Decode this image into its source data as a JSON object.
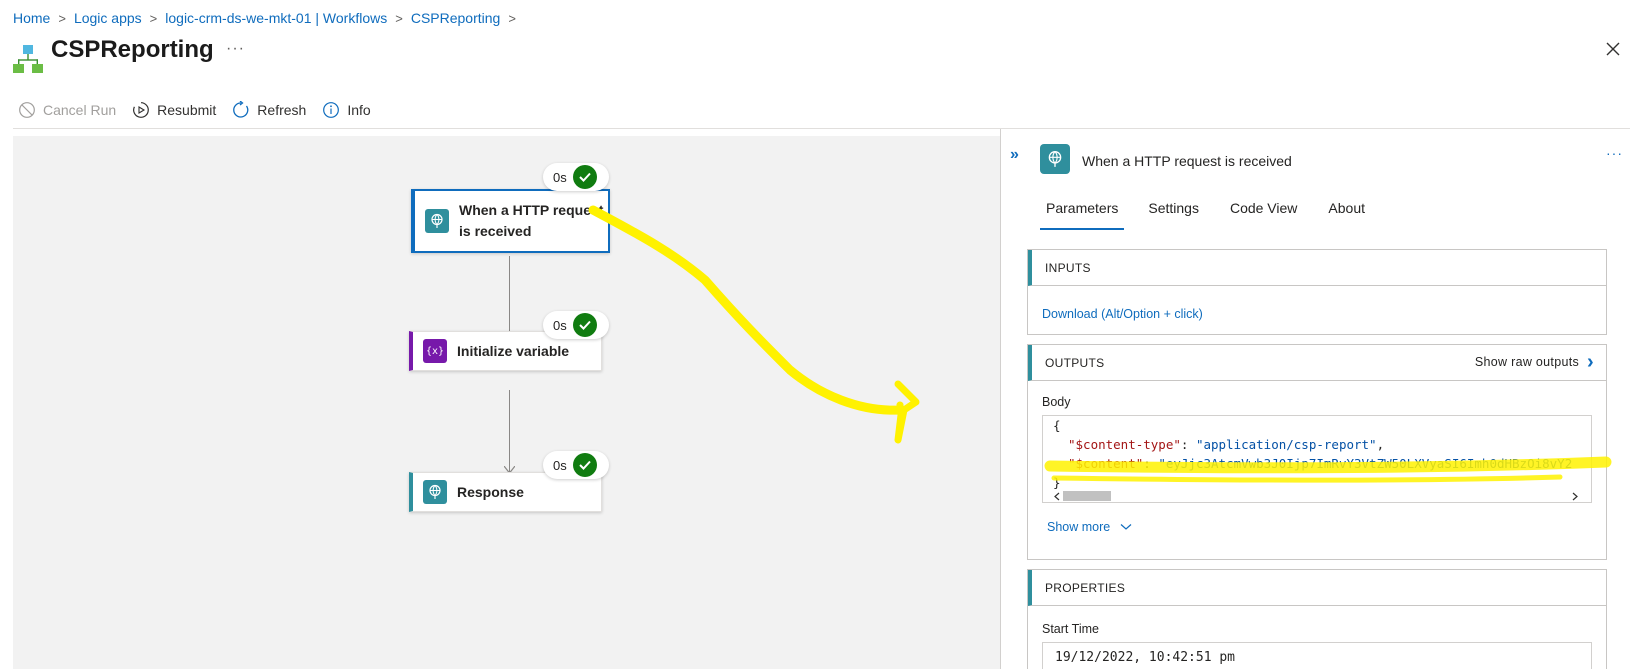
{
  "breadcrumb": {
    "items": [
      "Home",
      "Logic apps",
      "logic-crm-ds-we-mkt-01 | Workflows",
      "CSPReporting"
    ],
    "separator": ">"
  },
  "header": {
    "title": "CSPReporting",
    "more": "···"
  },
  "toolbar": {
    "cancel_run": "Cancel Run",
    "resubmit": "Resubmit",
    "refresh": "Refresh",
    "info": "Info"
  },
  "workflow": {
    "nodes": [
      {
        "label": "When a HTTP request is received",
        "duration": "0s",
        "status": "succeeded",
        "icon": "http-request-icon"
      },
      {
        "label": "Initialize variable",
        "duration": "0s",
        "status": "succeeded",
        "icon": "variable-icon"
      },
      {
        "label": "Response",
        "duration": "0s",
        "status": "succeeded",
        "icon": "response-icon"
      }
    ]
  },
  "panel": {
    "collapse": "»",
    "title": "When a HTTP request is received",
    "more": "···",
    "tabs": [
      "Parameters",
      "Settings",
      "Code View",
      "About"
    ],
    "active_tab": "Parameters",
    "inputs": {
      "header": "INPUTS",
      "download": "Download (Alt/Option + click)"
    },
    "outputs": {
      "header": "OUTPUTS",
      "show_raw": "Show raw outputs",
      "body_label": "Body",
      "code": {
        "open": "{",
        "key1": "\"$content-type\"",
        "val1": "\"application/csp-report\"",
        "key2": "\"$content\"",
        "val2": "\"eyJjc3AtcmVwb3J0Ijp7ImRvY3VtZW50LXVyaSI6Imh0dHBzOi8vY2",
        "close": "}"
      },
      "show_more": "Show more"
    },
    "properties": {
      "header": "PROPERTIES",
      "start_time_label": "Start Time",
      "start_time_value": "19/12/2022, 10:42:51 pm"
    }
  },
  "colors": {
    "accent": "#0f6cbd",
    "trigger": "#2f8f9d",
    "variable": "#7719aa",
    "success": "#107c10",
    "annotation": "#fff200"
  }
}
